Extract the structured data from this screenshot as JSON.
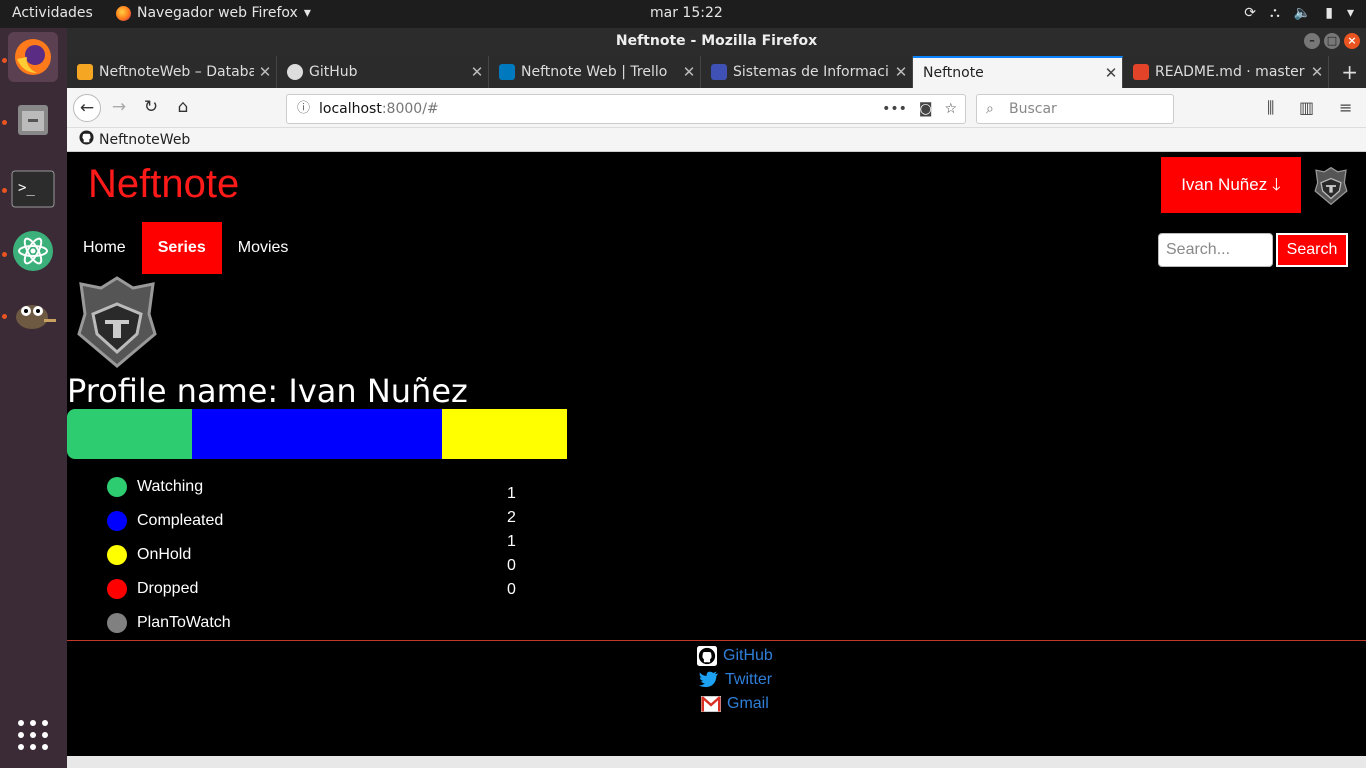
{
  "topbar": {
    "activities": "Actividades",
    "app_name": "Navegador web Firefox",
    "clock": "mar 15:22"
  },
  "window": {
    "title": "Neftnote - Mozilla Firefox"
  },
  "tabs": [
    {
      "label": "NeftnoteWeb – Databa",
      "icon_color": "#f5a623"
    },
    {
      "label": "GitHub",
      "icon_color": "#ffffff"
    },
    {
      "label": "Neftnote Web | Trello",
      "icon_color": "#0079bf"
    },
    {
      "label": "Sistemas de Informaci",
      "icon_color": "#3f51b5"
    },
    {
      "label": "Neftnote",
      "icon_color": ""
    },
    {
      "label": "README.md · master",
      "icon_color": "#e24329"
    }
  ],
  "navbar": {
    "url_host": "localhost",
    "url_rest": ":8000/#",
    "search_placeholder": "Buscar"
  },
  "bookmarks": [
    {
      "label": "NeftnoteWeb"
    }
  ],
  "site": {
    "brand": "Neftnote",
    "user_button": "Ivan Nuñez",
    "nav": [
      "Home",
      "Series",
      "Movies"
    ],
    "active_nav": "Series",
    "search_placeholder": "Search...",
    "search_button": "Search",
    "profile_label": "Profile name: Ivan Nuñez",
    "stats": [
      {
        "label": "Watching",
        "count": "1",
        "color": "#2ecc71"
      },
      {
        "label": "Compleated",
        "count": "2",
        "color": "#0000ff"
      },
      {
        "label": "OnHold",
        "count": "1",
        "color": "#ffff00"
      },
      {
        "label": "Dropped",
        "count": "0",
        "color": "#ff0000"
      },
      {
        "label": "PlanToWatch",
        "count": "0",
        "color": "#808080"
      }
    ],
    "footer_links": [
      {
        "label": "GitHub",
        "icon": "github-icon"
      },
      {
        "label": "Twitter",
        "icon": "twitter-icon"
      },
      {
        "label": "Gmail",
        "icon": "gmail-icon"
      }
    ],
    "accent": "#ff0000",
    "link_color": "#2f7fd8"
  }
}
